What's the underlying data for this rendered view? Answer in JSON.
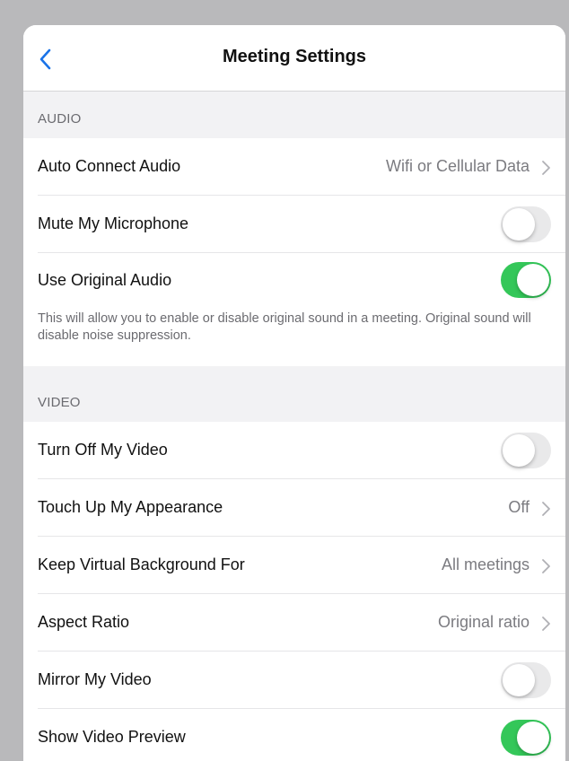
{
  "header": {
    "title": "Meeting Settings",
    "back_icon": "chevron-left-icon",
    "accent": "#1a73e8"
  },
  "audio": {
    "section_label": "AUDIO",
    "auto_connect": {
      "label": "Auto Connect Audio",
      "value": "Wifi or Cellular Data"
    },
    "mute_mic": {
      "label": "Mute My Microphone",
      "on": false
    },
    "original_audio": {
      "label": "Use Original Audio",
      "on": true
    },
    "description": "This will allow you to enable or disable original sound in a meeting. Original sound will disable noise suppression."
  },
  "video": {
    "section_label": "VIDEO",
    "turn_off_video": {
      "label": "Turn Off My Video",
      "on": false
    },
    "touch_up": {
      "label": "Touch Up My Appearance",
      "value": "Off"
    },
    "virtual_bg": {
      "label": "Keep Virtual Background For",
      "value": "All meetings"
    },
    "aspect_ratio": {
      "label": "Aspect Ratio",
      "value": "Original ratio"
    },
    "mirror": {
      "label": "Mirror My Video",
      "on": false
    },
    "preview": {
      "label": "Show Video Preview",
      "on": true
    }
  },
  "colors": {
    "toggle_on": "#34c759",
    "toggle_off": "#e9e9ea"
  }
}
